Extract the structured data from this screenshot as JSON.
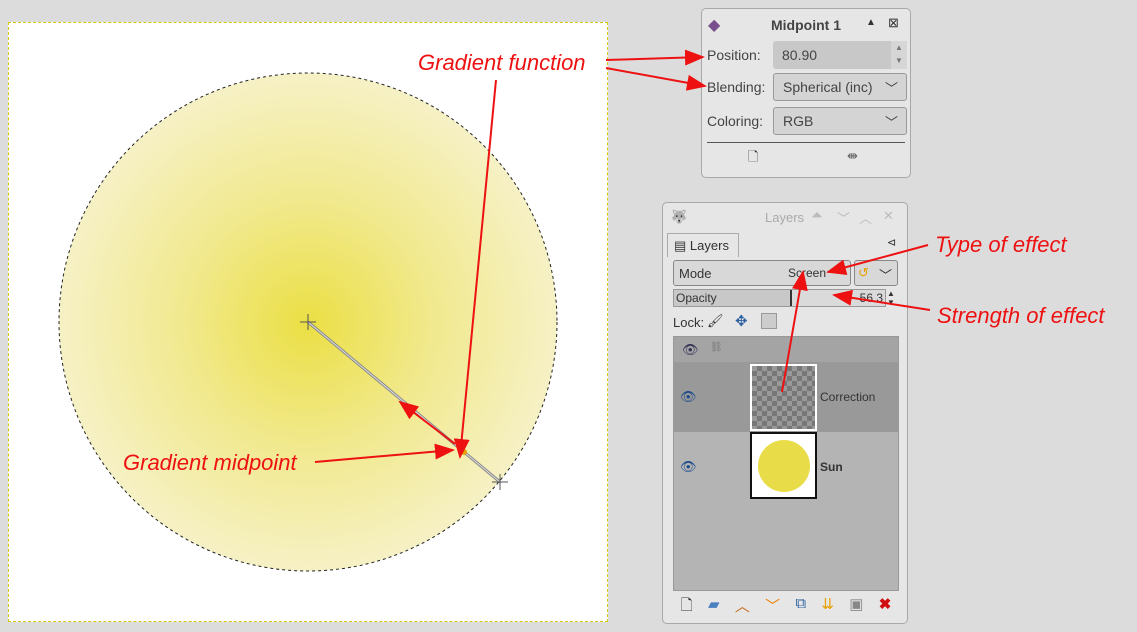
{
  "midpoint_dialog": {
    "title": "Midpoint 1",
    "position_label": "Position:",
    "position_value": "80.90",
    "blending_label": "Blending:",
    "blending_value": "Spherical (inc)",
    "coloring_label": "Coloring:",
    "coloring_value": "RGB"
  },
  "layers_panel": {
    "window_title": "Layers",
    "tab_label": "Layers",
    "mode_label": "Mode",
    "mode_value": "Screen",
    "opacity_label": "Opacity",
    "opacity_value": "56.3",
    "lock_label": "Lock:",
    "layers": [
      {
        "name": "Correction",
        "visible": true
      },
      {
        "name": "Sun",
        "visible": true
      }
    ]
  },
  "annotations": {
    "gradient_function": "Gradient function",
    "gradient_midpoint": "Gradient midpoint",
    "type_of_effect": "Type of effect",
    "strength_of_effect": "Strength of effect"
  },
  "colors": {
    "annotation": "#ee1111",
    "sun": "#e8dc48"
  }
}
